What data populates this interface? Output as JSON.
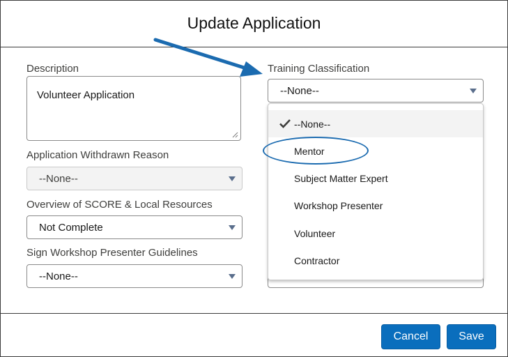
{
  "dialog": {
    "title": "Update Application"
  },
  "fields": {
    "description": {
      "label": "Description",
      "value": "Volunteer Application"
    },
    "withdrawn_reason": {
      "label": "Application Withdrawn Reason",
      "value": "--None--"
    },
    "overview": {
      "label": "Overview of SCORE & Local Resources",
      "value": "Not Complete"
    },
    "sign_guidelines": {
      "label": "Sign Workshop Presenter Guidelines",
      "value": "--None--"
    },
    "training_classification": {
      "label": "Training Classification",
      "value": "--None--",
      "options": [
        "--None--",
        "Mentor",
        "Subject Matter Expert",
        "Workshop Presenter",
        "Volunteer",
        "Contractor"
      ],
      "selected_index": 0,
      "highlighted_option": "Mentor"
    }
  },
  "footer": {
    "cancel_label": "Cancel",
    "save_label": "Save"
  },
  "colors": {
    "primary_button": "#0a6ebd",
    "annotation": "#1b6bb0"
  },
  "icons": {
    "selected_option": "check-icon",
    "select_toggle": "chevron-down-icon"
  }
}
